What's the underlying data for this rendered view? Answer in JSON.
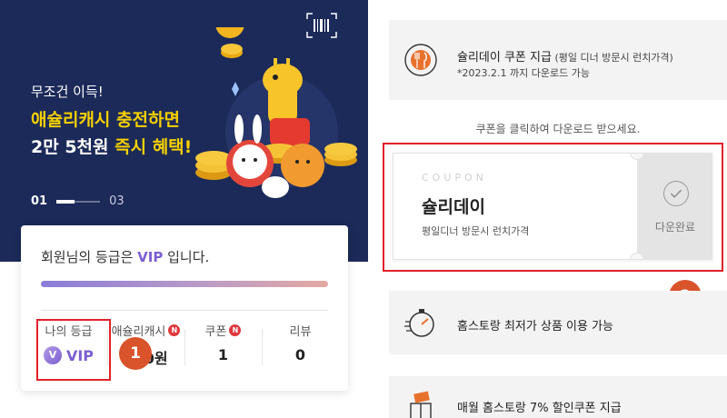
{
  "banner": {
    "subtitle": "무조건 이득!",
    "headline_line1": "애슐리캐시 충전하면",
    "headline_line2_main": "2만 5천원 ",
    "headline_line2_accent": "즉시 혜택!",
    "pager_current": "01",
    "pager_total": "03",
    "barcode_icon": "barcode-icon"
  },
  "grade": {
    "text_prefix": "회원님의 등급은 ",
    "grade_name": "VIP",
    "text_suffix": " 입니다.",
    "stats": [
      {
        "label": "나의 등급",
        "value": "VIP",
        "badge": "",
        "coin": "V"
      },
      {
        "label": "애슐리캐시",
        "value": "760원",
        "badge": "N"
      },
      {
        "label": "쿠폰",
        "value": "1",
        "badge": "N"
      },
      {
        "label": "리뷰",
        "value": "0",
        "badge": ""
      }
    ]
  },
  "markers": {
    "first": "1",
    "second": "2"
  },
  "benefits": {
    "items": [
      {
        "title": "슐리데이 쿠폰 지급",
        "title_small": " (평일 디너 방문시 런치가격)",
        "note": "*2023.2.1 까지 다운로드 가능",
        "icon": "fork-knife-icon"
      },
      {
        "title": "홈스토랑 최저가 상품 이용 가능",
        "icon": "stopwatch-icon"
      },
      {
        "title": "매월 홈스토랑 7% 할인쿠폰 지급",
        "icon": "gift-coupon-icon"
      }
    ]
  },
  "coupon": {
    "hint": "쿠폰을 클릭하여 다운로드 받으세요.",
    "label": "COUPON",
    "name": "슐리데이",
    "description": "평일디너 방문시 런치가격",
    "status": "다운완료"
  },
  "colors": {
    "banner_bg": "#1b2a59",
    "highlight_yellow": "#f7d000",
    "vip_purple": "#7a5fd1",
    "annotation_red": "#e0212a",
    "marker_orange": "#d9532b"
  }
}
